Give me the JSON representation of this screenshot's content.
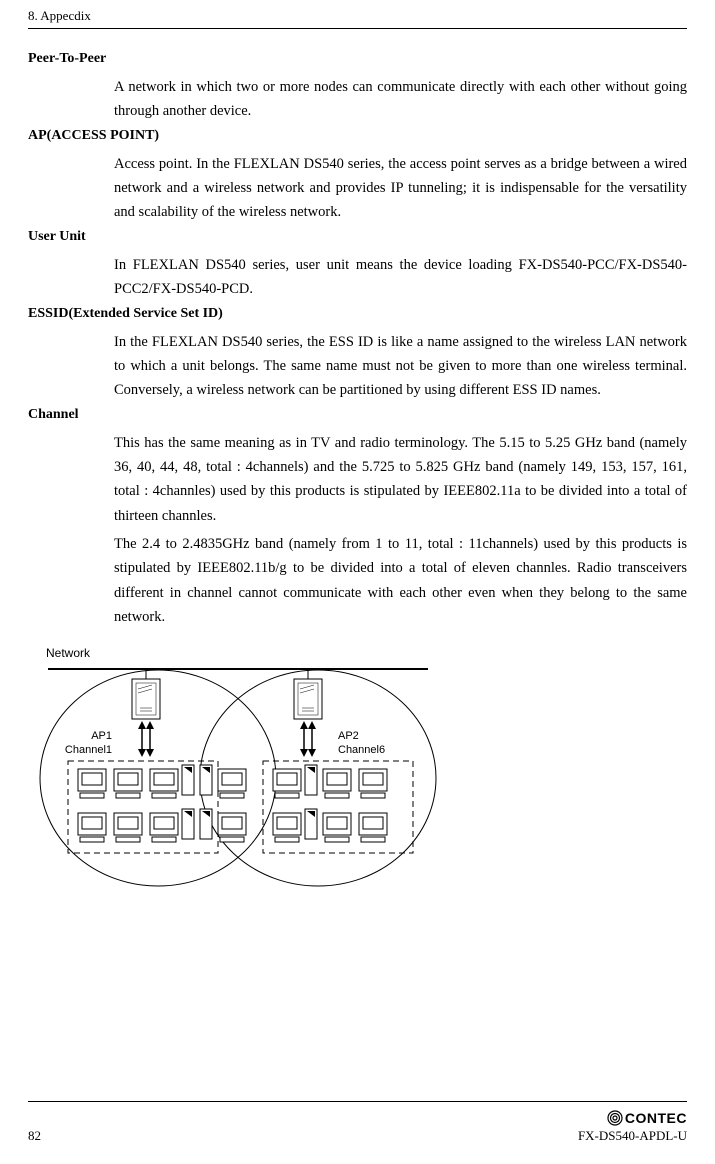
{
  "header": {
    "chapter": "8. Appecdix"
  },
  "terms": {
    "peer": {
      "title": "Peer-To-Peer",
      "body": "A network in which two or more nodes can communicate directly with each other without going through another device."
    },
    "ap": {
      "title": "AP(ACCESS POINT)",
      "body": "Access point.  In the FLEXLAN DS540 series, the access point serves as a bridge between a wired network and a wireless network and provides IP tunneling; it is indispensable for the versatility and scalability of the wireless network."
    },
    "userunit": {
      "title": "User Unit",
      "body": "In FLEXLAN DS540 series, user unit means the device loading FX-DS540-PCC/FX-DS540-PCC2/FX-DS540-PCD."
    },
    "essid": {
      "title": "ESSID(Extended Service Set ID)",
      "body": "In the FLEXLAN DS540 series, the ESS ID is like a name assigned to the wireless LAN network to which a unit belongs.  The same name must not be given to more than one wireless terminal.  Conversely, a wireless network can be partitioned by using different ESS ID names."
    },
    "channel": {
      "title": "Channel",
      "body1": "This has the same meaning as in TV and radio terminology.  The 5.15 to 5.25 GHz band (namely 36, 40, 44, 48, total : 4channels) and the 5.725 to 5.825 GHz band (namely 149, 153, 157, 161, total : 4channles) used by this products is stipulated by IEEE802.11a to be divided into a total of thirteen channles.",
      "body2": "The 2.4 to 2.4835GHz band (namely from 1 to 11, total : 11channels) used by this products is stipulated by IEEE802.11b/g to be divided into a total of eleven channles.  Radio transceivers different in channel cannot communicate with each other even when they belong to the same network."
    }
  },
  "diagram": {
    "network_label": "Network",
    "ap1_name": "AP1",
    "ap1_channel": "Channel1",
    "ap2_name": "AP2",
    "ap2_channel": "Channel6"
  },
  "footer": {
    "page": "82",
    "brand": "CONTEC",
    "model": "FX-DS540-APDL-U"
  }
}
